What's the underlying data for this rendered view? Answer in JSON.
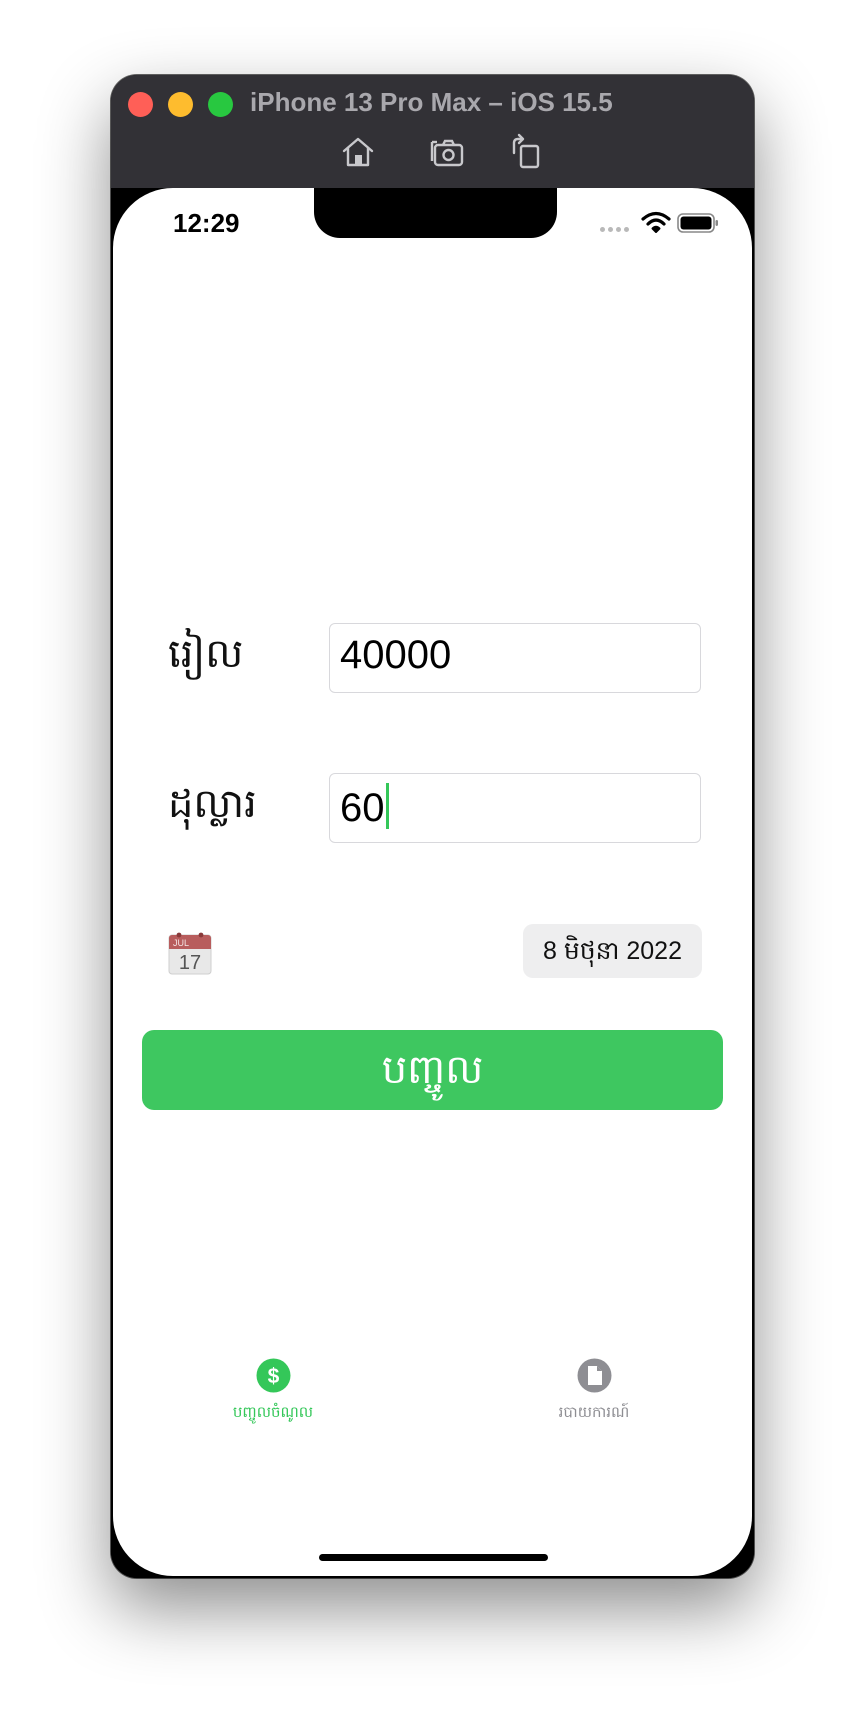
{
  "window": {
    "title": "iPhone 13 Pro Max – iOS 15.5",
    "toolbar_icons": [
      "home-icon",
      "screenshot-icon",
      "rotate-icon"
    ]
  },
  "status_bar": {
    "time": "12:29",
    "icons": [
      "cellular-dots-icon",
      "wifi-icon",
      "battery-icon"
    ]
  },
  "form": {
    "riel_label": "រៀល",
    "riel_value": "40000",
    "dollar_label": "ដុល្លារ",
    "dollar_value": "60",
    "calendar_icon": "calendar-icon",
    "calendar_month": "JUL",
    "calendar_day": "17",
    "date_value": "8 មិថុនា 2022",
    "submit_label": "បញ្ចូល"
  },
  "tab_bar": {
    "items": [
      {
        "label": "បញ្ចូលចំណូល",
        "icon": "dollar-icon",
        "selected": true
      },
      {
        "label": "របាយការណ៍",
        "icon": "document-icon",
        "selected": false
      }
    ]
  },
  "colors": {
    "accent": "#34c759",
    "button": "#3ec760",
    "titlebar": "#323136",
    "tab_inactive": "#8e8e93"
  }
}
